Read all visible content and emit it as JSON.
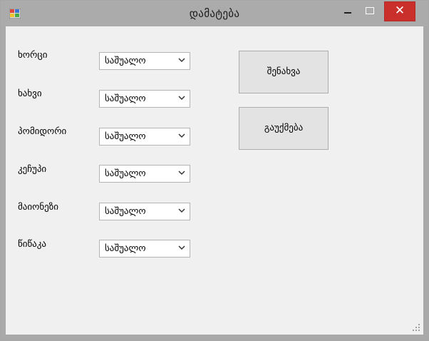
{
  "window": {
    "title": "დამატება",
    "icon": "app-window-icon",
    "controls": {
      "minimize": "minimize-icon",
      "maximize": "maximize-icon",
      "close_label": "✕"
    }
  },
  "form": {
    "rows": [
      {
        "label": "ხორცი",
        "value": "საშუალო"
      },
      {
        "label": "ხახვი",
        "value": "საშუალო"
      },
      {
        "label": "პომიდორი",
        "value": "საშუალო"
      },
      {
        "label": "კეჩუპი",
        "value": "საშუალო"
      },
      {
        "label": "მაიონეზი",
        "value": "საშუალო"
      },
      {
        "label": "წიწაკა",
        "value": "საშუალო"
      }
    ]
  },
  "buttons": {
    "save_label": "შენახვა",
    "cancel_label": "გაუქმება"
  },
  "colors": {
    "client_bg": "#f0f0f0",
    "title_bg": "#ababab",
    "close_bg": "#c9302c"
  }
}
